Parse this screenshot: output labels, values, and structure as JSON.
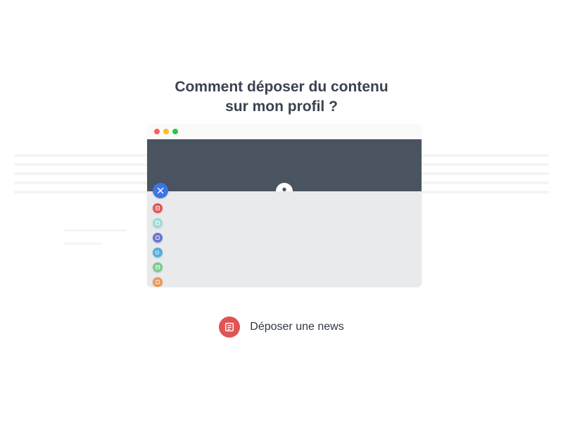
{
  "heading": {
    "line1": "Comment déposer du contenu",
    "line2": "sur mon profil ?"
  },
  "fab": {
    "main": {
      "name": "close-icon",
      "color": "#3b74e7"
    },
    "items": [
      {
        "name": "news-icon",
        "color": "#e25553"
      },
      {
        "name": "photo-icon",
        "color": "#9fdcd5"
      },
      {
        "name": "folder-icon",
        "color": "#6c77cf"
      },
      {
        "name": "video-icon",
        "color": "#57aee2"
      },
      {
        "name": "calendar-icon",
        "color": "#7ecb8c"
      },
      {
        "name": "link-icon",
        "color": "#e99a5a"
      }
    ]
  },
  "action": {
    "icon": "news-icon",
    "label": "Déposer une news"
  }
}
